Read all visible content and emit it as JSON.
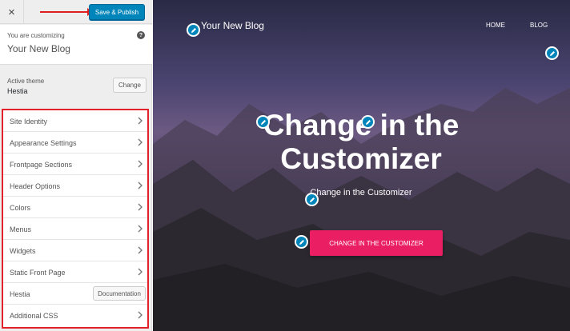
{
  "topbar": {
    "close_label": "×",
    "save_label": "Save & Publish"
  },
  "customizing": {
    "small_label": "You are customizing",
    "site_name": "Your New Blog",
    "help_icon": "question-circle-icon"
  },
  "theme": {
    "label": "Active theme",
    "name": "Hestia",
    "change_label": "Change"
  },
  "menu": {
    "items": [
      "Site Identity",
      "Appearance Settings",
      "Frontpage Sections",
      "Header Options",
      "Colors",
      "Menus",
      "Widgets",
      "Static Front Page",
      "Hestia",
      "Additional CSS"
    ],
    "documentation_label": "Documentation"
  },
  "preview": {
    "brand": "Your New Blog",
    "nav": [
      "HOME",
      "BLOG"
    ],
    "hero_title_line1": "Change in the",
    "hero_title_line2": "Customizer",
    "hero_subtitle": "Change in the Customizer",
    "cta_label": "CHANGE IN THE CUSTOMIZER"
  },
  "colors": {
    "accent": "#0085ba",
    "cta": "#e91e63",
    "highlight": "#e3212b"
  }
}
